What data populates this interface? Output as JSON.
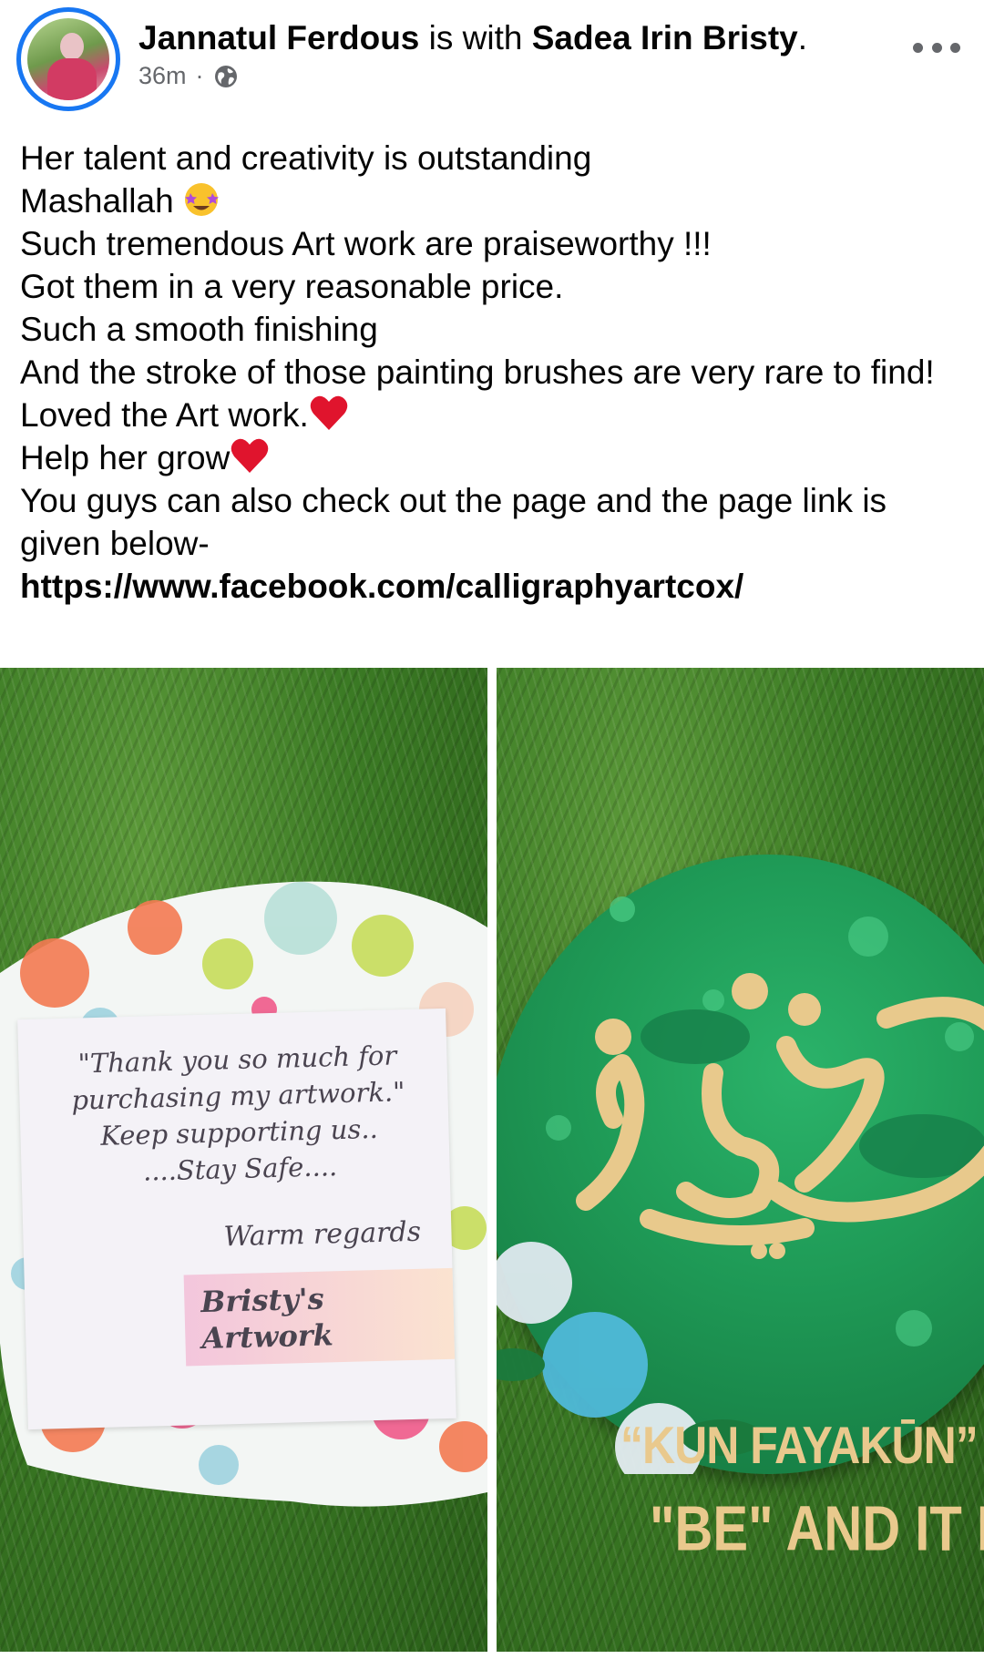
{
  "post": {
    "author": "Jannatul Ferdous",
    "with_text": " is with ",
    "tagged": "Sadea Irin Bristy",
    "tagged_suffix": ".",
    "time": "36m",
    "separator": "·",
    "privacy_icon": "globe-icon",
    "more_icon": "more-options-icon"
  },
  "body": {
    "line1": "Her talent and creativity is outstanding",
    "line2": "Mashallah",
    "line2_emoji": "🤩",
    "line3": "Such tremendous Art work are praiseworthy !!!",
    "line4": "Got them in a very reasonable price.",
    "line5": "Such a smooth finishing",
    "line6": "And the stroke of those painting brushes are very rare to find!",
    "line7": "Loved the Art work.",
    "line7_emoji": "❤️",
    "line8": "Help her grow",
    "line8_emoji": "❤️",
    "line9": "You guys can also check out the page and the page link is given below-",
    "link": "https://www.facebook.com/calligraphyartcox/"
  },
  "photos": {
    "left": {
      "note_line1": "\"Thank you so much for",
      "note_line2": "purchasing my artwork.\"",
      "note_line3": "Keep supporting us..",
      "note_line4": "....Stay Safe....",
      "note_regards": "Warm regards",
      "note_brand": "Bristy's Artwork"
    },
    "right": {
      "caption1": "“KUN FAYAKŪN”",
      "caption2": "\"BE\" AND IT IS!"
    }
  },
  "colors": {
    "accent_ring": "#1877f2",
    "text": "#050505",
    "meta": "#65676b",
    "heart": "#e0142d"
  }
}
